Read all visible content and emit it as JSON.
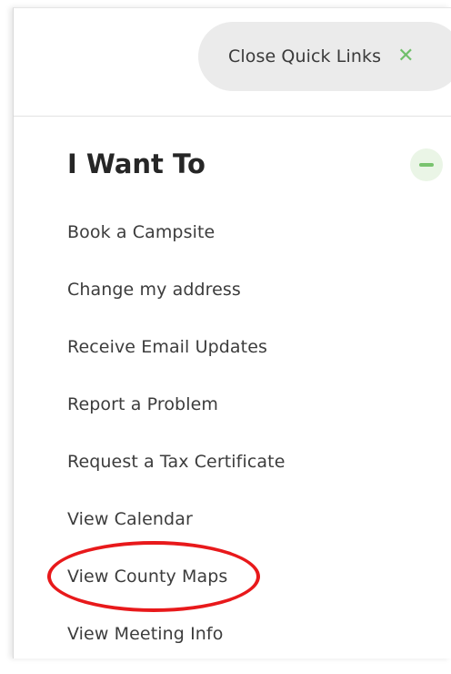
{
  "quick_links": {
    "close_label": "Close Quick Links",
    "close_icon": "close-x-icon",
    "accent_color": "#6fbf6a"
  },
  "section": {
    "title": "I Want To",
    "collapse_icon": "minus-icon",
    "links": [
      {
        "label": "Book a Campsite"
      },
      {
        "label": "Change my address"
      },
      {
        "label": "Receive Email Updates"
      },
      {
        "label": "Report a Problem"
      },
      {
        "label": "Request a Tax Certificate"
      },
      {
        "label": "View Calendar"
      },
      {
        "label": "View County Maps"
      },
      {
        "label": "View Meeting Info"
      }
    ]
  },
  "annotation": {
    "highlighted_item": "View County Maps",
    "color": "#e8191b"
  }
}
